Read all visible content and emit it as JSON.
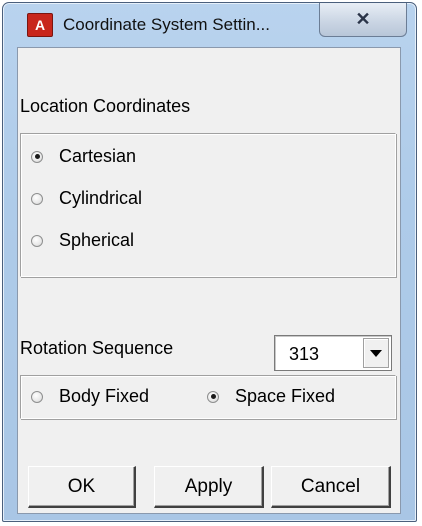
{
  "window": {
    "title": "Coordinate System Settin...",
    "app_icon_letter": "A",
    "close_glyph": "✕"
  },
  "location": {
    "label": "Location Coordinates",
    "options": [
      "Cartesian",
      "Cylindrical",
      "Spherical"
    ],
    "selected": "Cartesian"
  },
  "rotation": {
    "label": "Rotation Sequence",
    "value": "313",
    "modes": [
      "Body Fixed",
      "Space Fixed"
    ],
    "selected_mode": "Space Fixed"
  },
  "buttons": {
    "ok": "OK",
    "apply": "Apply",
    "cancel": "Cancel"
  },
  "colors": {
    "title_gradient": "#b9d3ee",
    "app_icon": "#c8261c",
    "client_bg": "#f0f0f0"
  }
}
